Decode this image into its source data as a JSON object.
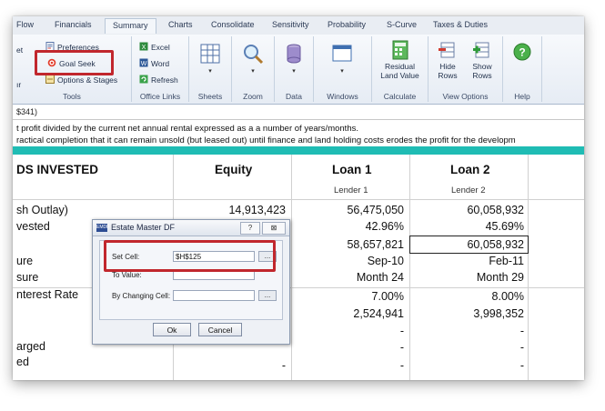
{
  "tabs": [
    "Flow",
    "Financials",
    "Summary",
    "Charts",
    "Consolidate",
    "Sensitivity",
    "Probability",
    "S-Curve",
    "Taxes & Duties"
  ],
  "active_tab": "Summary",
  "ribbon": {
    "tools": {
      "items": [
        "Preferences",
        "Goal Seek",
        "Options & Stages"
      ],
      "label": "Tools",
      "left_fragments": [
        "et",
        "ır"
      ]
    },
    "office_links": {
      "items": [
        "Excel",
        "Word",
        "Refresh"
      ],
      "label": "Office Links"
    },
    "sheets": {
      "label": "Sheets"
    },
    "zoom": {
      "label": "Zoom"
    },
    "data": {
      "label": "Data"
    },
    "windows": {
      "label": "Windows"
    },
    "calculate": {
      "button": [
        "Residual",
        "Land Value"
      ],
      "label": "Calculate"
    },
    "view_options": {
      "hide": [
        "Hide",
        "Rows"
      ],
      "show": [
        "Show",
        "Rows"
      ],
      "label": "View Options"
    },
    "help": {
      "label": "Help"
    }
  },
  "formula_bar": "$341)",
  "descriptions": [
    "t profit divided by the current net annual rental expressed as a a number of years/months.",
    "ractical completion that it can remain unsold (but leased out) until finance and land holding costs erodes the profit for the developm"
  ],
  "table": {
    "title": "DS INVESTED",
    "columns": [
      {
        "name": "Equity",
        "sub": ""
      },
      {
        "name": "Loan 1",
        "sub": "Lender 1"
      },
      {
        "name": "Loan 2",
        "sub": "Lender 2"
      }
    ],
    "rows": [
      {
        "label": "sh Outlay)",
        "values": [
          "14,913,423",
          "56,475,050",
          "60,058,932"
        ]
      },
      {
        "label": "vested",
        "values": [
          "",
          "42.96%",
          "45.69%"
        ]
      },
      {
        "label": "",
        "values": [
          "",
          "58,657,821",
          "60,058,932"
        ]
      },
      {
        "label": "ure",
        "values": [
          "",
          "Sep-10",
          "Feb-11"
        ]
      },
      {
        "label": "sure",
        "values": [
          "",
          "Month 24",
          "Month 29"
        ]
      },
      {
        "label": "nterest Rate",
        "values": [
          "",
          "7.00%",
          "8.00%"
        ]
      },
      {
        "label": "",
        "values": [
          "",
          "2,524,941",
          "3,998,352"
        ]
      },
      {
        "label": "",
        "values": [
          "",
          "-",
          "-"
        ]
      },
      {
        "label": "arged",
        "values": [
          "",
          "-",
          "-"
        ]
      },
      {
        "label": "ed",
        "values": [
          "-",
          "-",
          "-"
        ]
      }
    ]
  },
  "dialog": {
    "title": "Estate Master DF",
    "logo": "EMDF",
    "help_btn": "?",
    "close_btn": "⊠",
    "set_cell_label": "Set Cell:",
    "set_cell_value": "$H$125",
    "to_value_label": "To Value:",
    "to_value_value": "",
    "changing_label": "By Changing Cell:",
    "changing_value": "",
    "picker": "...",
    "ok": "Ok",
    "cancel": "Cancel"
  },
  "colors": {
    "highlight": "#c1272d",
    "teal": "#1fbcb4"
  }
}
